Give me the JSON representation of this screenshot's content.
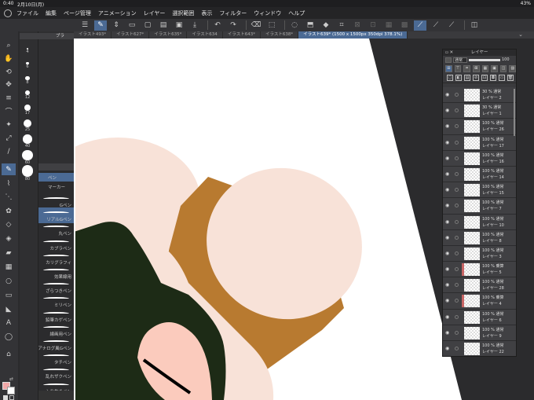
{
  "status": {
    "time": "0:40",
    "date": "2月10日(月)",
    "battery": "43%"
  },
  "menu": [
    "ファイル",
    "編集",
    "ページ管理",
    "アニメーション",
    "レイヤー",
    "選択範囲",
    "表示",
    "フィルター",
    "ウィンドウ",
    "ヘルプ"
  ],
  "tabs": [
    {
      "label": "イラスト493*",
      "active": false
    },
    {
      "label": "イラスト627*",
      "active": false
    },
    {
      "label": "イラスト635*",
      "active": false
    },
    {
      "label": "イラスト634",
      "active": false
    },
    {
      "label": "イラスト643*",
      "active": false
    },
    {
      "label": "イラスト638*",
      "active": false
    },
    {
      "label": "イラスト639* (1500 x 1500px 350dpi 378.1%)",
      "active": true
    }
  ],
  "brush_size_header": "ブラ",
  "brush_sizes": [
    "4",
    "5",
    "6",
    "7",
    "8",
    "10",
    "12",
    "15",
    "17",
    "20",
    "25",
    "30",
    "40",
    "50",
    "60",
    "70",
    "80",
    "100"
  ],
  "selected_brush_size": "10",
  "subtools": {
    "categories": [
      {
        "label": "ペン",
        "selected": true
      },
      {
        "label": "マーカー",
        "selected": false
      }
    ],
    "brushes": [
      "Gペン",
      "リアルGペン",
      "丸ペン",
      "カブラペン",
      "カリグラフィ",
      "効果線用",
      "ざらつきペン",
      "ミリペン",
      "鉛筆カゲペン",
      "線画用ペン",
      "アナログ風Gペン",
      "タチペン",
      "乱れザクペン",
      "入り抜きペン"
    ],
    "selected_brush": "リアルGペン"
  },
  "layer_panel": {
    "title": "レイヤー",
    "blend_mode": "通常",
    "opacity": "100",
    "layers": [
      {
        "pct": "30 %",
        "mode": "通常",
        "name": "レイヤー 2",
        "red": false
      },
      {
        "pct": "30 %",
        "mode": "通常",
        "name": "レイヤー 1",
        "red": false
      },
      {
        "pct": "100 %",
        "mode": "通常",
        "name": "レイヤー 26",
        "red": false
      },
      {
        "pct": "100 %",
        "mode": "通常",
        "name": "レイヤー 17",
        "red": false
      },
      {
        "pct": "100 %",
        "mode": "通常",
        "name": "レイヤー 16",
        "red": false
      },
      {
        "pct": "100 %",
        "mode": "通常",
        "name": "レイヤー 14",
        "red": false
      },
      {
        "pct": "100 %",
        "mode": "通常",
        "name": "レイヤー 15",
        "red": false
      },
      {
        "pct": "100 %",
        "mode": "通常",
        "name": "レイヤー 7",
        "red": false
      },
      {
        "pct": "100 %",
        "mode": "通常",
        "name": "レイヤー 10",
        "red": false
      },
      {
        "pct": "100 %",
        "mode": "通常",
        "name": "レイヤー 8",
        "red": false
      },
      {
        "pct": "100 %",
        "mode": "通常",
        "name": "レイヤー 3",
        "red": false
      },
      {
        "pct": "100 %",
        "mode": "乗算",
        "name": "レイヤー 5",
        "red": true
      },
      {
        "pct": "100 %",
        "mode": "通常",
        "name": "レイヤー 28",
        "red": false
      },
      {
        "pct": "100 %",
        "mode": "乗算",
        "name": "レイヤー 4",
        "red": true
      },
      {
        "pct": "100 %",
        "mode": "通常",
        "name": "レイヤー 6",
        "red": false
      },
      {
        "pct": "100 %",
        "mode": "通常",
        "name": "レイヤー 9",
        "red": false
      },
      {
        "pct": "100 %",
        "mode": "通常",
        "name": "レイヤー 22",
        "red": false
      }
    ]
  },
  "colors": {
    "accent": "#4b6a94",
    "main_color": "#f0a7a7",
    "canvas_peach": "#f8e2d8",
    "canvas_ochre": "#b87a30",
    "canvas_green": "#1d2b16",
    "canvas_pink": "#fbcbbd"
  }
}
